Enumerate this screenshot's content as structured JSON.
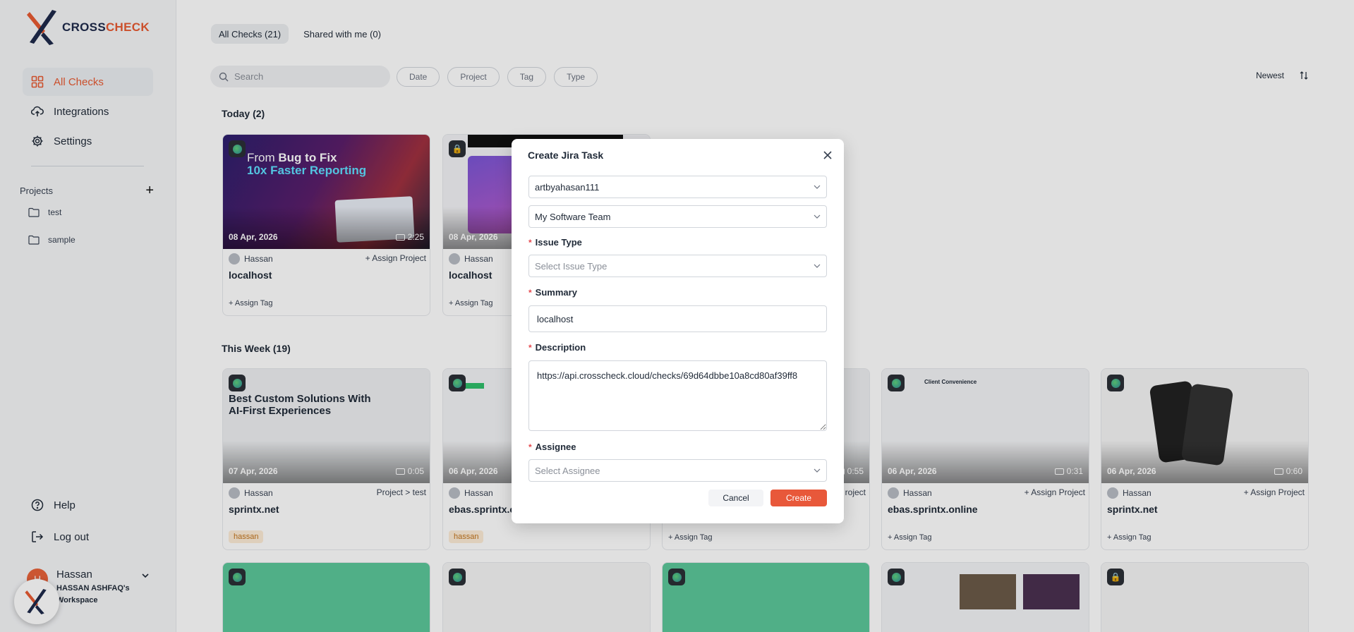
{
  "brand": {
    "part1": "CROSS",
    "part2": "CHECK",
    "accent": "#e85a32",
    "dark": "#1e2a4a"
  },
  "sidebar": {
    "nav": [
      {
        "label": "All Checks",
        "icon": "grid-icon",
        "active": true
      },
      {
        "label": "Integrations",
        "icon": "cloud-upload-icon"
      },
      {
        "label": "Settings",
        "icon": "gear-icon"
      }
    ],
    "projects_label": "Projects",
    "projects": [
      "test",
      "sample"
    ],
    "help_label": "Help",
    "logout_label": "Log out",
    "user": {
      "initial": "H",
      "name": "Hassan",
      "workspace": "HASSAN ASHFAQ's Workspace"
    }
  },
  "main": {
    "tabs": [
      "All Checks (21)",
      "Shared with me (0)"
    ],
    "search_placeholder": "Search",
    "filters": [
      "Date",
      "Project",
      "Tag",
      "Type"
    ],
    "sort_label": "Newest",
    "today": {
      "title": "Today (2)",
      "cards": [
        {
          "date": "08 Apr, 2026",
          "duration": "2:25",
          "user": "Hassan",
          "project": "+ Assign Project",
          "site": "localhost",
          "tag": "+ Assign Tag"
        },
        {
          "date": "08 Apr, 2026",
          "user": "Hassan",
          "site": "localhost",
          "tag": "+ Assign Tag"
        }
      ]
    },
    "week": {
      "title": "This Week (19)",
      "cards": [
        {
          "date": "07 Apr, 2026",
          "duration": "0:05",
          "user": "Hassan",
          "project": "Project > test",
          "site": "sprintx.net",
          "chip": "hassan"
        },
        {
          "date": "06 Apr, 2026",
          "user": "Hassan",
          "site": "ebas.sprintx.c",
          "chip": "hassan"
        },
        {
          "duration": "0:55",
          "project": "roject",
          "tag": "+ Assign Tag"
        },
        {
          "date": "06 Apr, 2026",
          "duration": "0:31",
          "user": "Hassan",
          "project": "+ Assign Project",
          "site": "ebas.sprintx.online",
          "tag": "+ Assign Tag"
        },
        {
          "date": "06 Apr, 2026",
          "duration": "0:60",
          "user": "Hassan",
          "project": "+ Assign Project",
          "site": "sprintx.net",
          "tag": "+ Assign Tag"
        }
      ]
    }
  },
  "modal": {
    "title": "Create Jira Task",
    "site_value": "artbyahasan111",
    "project_value": "My Software Team",
    "issue_type_label": "Issue Type",
    "issue_type_placeholder": "Select Issue Type",
    "summary_label": "Summary",
    "summary_value": "localhost",
    "description_label": "Description",
    "description_value": "https://api.crosscheck.cloud/checks/69d64dbbe10a8cd80af39ff8",
    "assignee_label": "Assignee",
    "assignee_placeholder": "Select Assignee",
    "cancel_label": "Cancel",
    "create_label": "Create"
  }
}
